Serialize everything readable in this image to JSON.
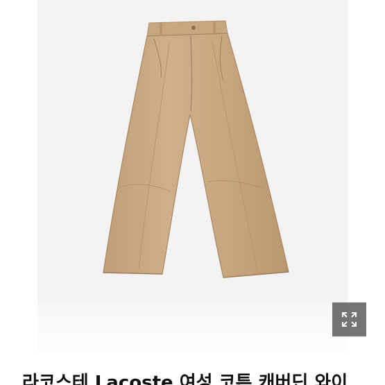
{
  "product": {
    "image_alt": "베이지 와이드 팬츠",
    "pants_color": "#c9a983",
    "photo_background": "#f3f3f3",
    "title": "라코스테 Lacoste 여성 코튼 캐버딘 와이"
  },
  "viewer": {
    "expand_icon": "expand-arrows-icon",
    "expand_button_color": "#555555"
  }
}
